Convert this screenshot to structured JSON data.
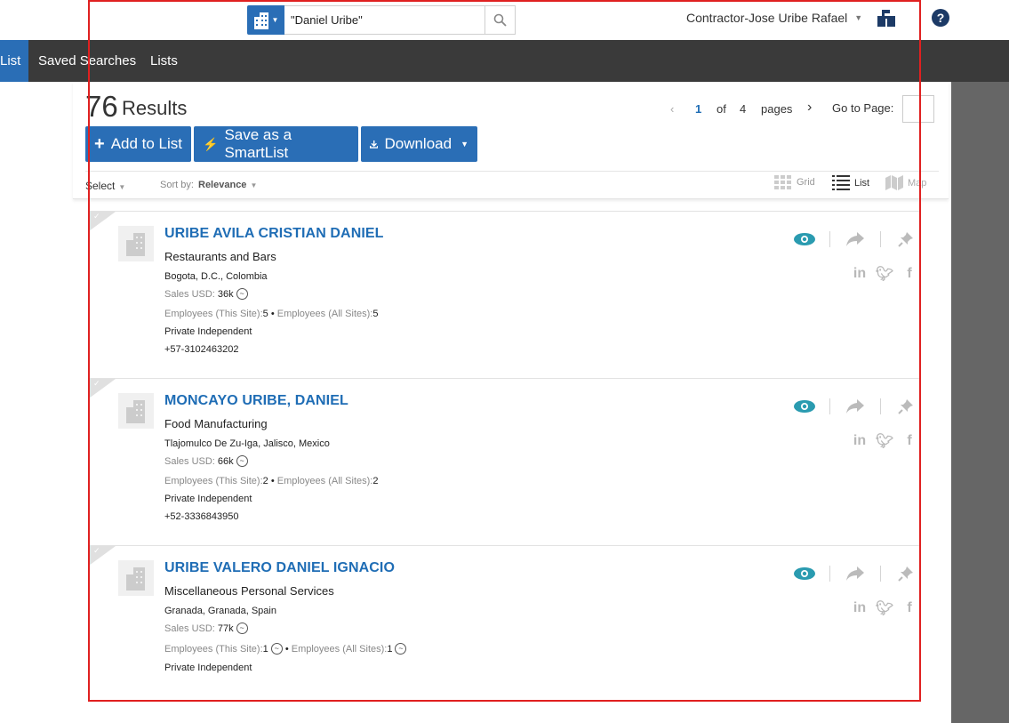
{
  "header": {
    "search_value": "\"Daniel Uribe\"",
    "user_name": "Contractor-Jose Uribe Rafael"
  },
  "nav": {
    "items": [
      {
        "label": "List",
        "active": true
      },
      {
        "label": "Saved Searches",
        "active": false
      },
      {
        "label": "Lists",
        "active": false
      }
    ]
  },
  "results": {
    "count": "76",
    "label": "Results",
    "pagination": {
      "prev": "‹",
      "current": "1",
      "of": "of",
      "total": "4",
      "pages": "pages",
      "next": "›",
      "goto_label": "Go to Page:"
    }
  },
  "toolbar": {
    "add_to_list": "Add to List",
    "save_smartlist": "Save as a SmartList",
    "download": "Download",
    "select": "Select",
    "sort_label": "Sort by:",
    "sort_value": "Relevance",
    "views": {
      "grid": "Grid",
      "list": "List",
      "map": "Map"
    }
  },
  "companies": [
    {
      "name": "URIBE AVILA CRISTIAN DANIEL",
      "industry": "Restaurants and Bars",
      "location": "Bogota, D.C., Colombia",
      "sales_label": "Sales USD:",
      "sales": "36k",
      "emp_site_label": "Employees (This Site):",
      "emp_site": "5",
      "emp_all_label": "Employees (All Sites):",
      "emp_all": "5",
      "ownership": "Private Independent",
      "phone": "+57-3102463202"
    },
    {
      "name": "MONCAYO URIBE, DANIEL",
      "industry": "Food Manufacturing",
      "location": "Tlajomulco De Zu-Iga, Jalisco, Mexico",
      "sales_label": "Sales USD:",
      "sales": "66k",
      "emp_site_label": "Employees (This Site):",
      "emp_site": "2",
      "emp_all_label": "Employees (All Sites):",
      "emp_all": "2",
      "ownership": "Private Independent",
      "phone": "+52-3336843950"
    },
    {
      "name": "URIBE VALERO DANIEL IGNACIO",
      "industry": "Miscellaneous Personal Services",
      "location": "Granada, Granada, Spain",
      "sales_label": "Sales USD:",
      "sales": "77k",
      "emp_site_label": "Employees (This Site):",
      "emp_site": "1",
      "emp_all_label": "Employees (All Sites):",
      "emp_all": "1",
      "ownership": "Private Independent",
      "phone": ""
    }
  ],
  "colors": {
    "brand_blue": "#2a6eb6",
    "link_blue": "#1f6db5",
    "nav_bg": "#3a3a3a",
    "eye_teal": "#2a9bb0",
    "highlight": "#e02020"
  }
}
